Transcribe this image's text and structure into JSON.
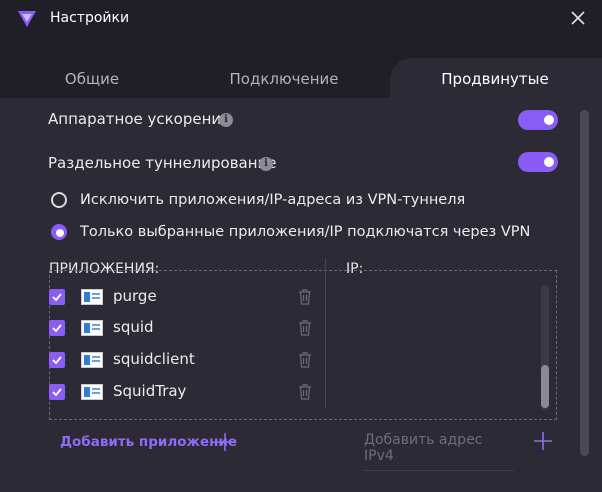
{
  "window": {
    "title": "Настройки"
  },
  "tabs": [
    {
      "label": "Общие"
    },
    {
      "label": "Подключение"
    },
    {
      "label": "Продвинутые"
    }
  ],
  "settings": {
    "hw_accel": {
      "label": "Аппаратное ускорение",
      "enabled": true
    },
    "split_tunnel": {
      "label": "Раздельное туннелирование",
      "enabled": true
    }
  },
  "radio": {
    "exclude": {
      "label": "Исключить приложения/IP-адреса из VPN-туннеля",
      "selected": false
    },
    "include": {
      "label": "Только выбранные приложения/IP подключатся через VPN",
      "selected": true
    }
  },
  "apps": {
    "header": "ПРИЛОЖЕНИЯ:",
    "items": [
      {
        "name": "purge",
        "checked": true
      },
      {
        "name": "squid",
        "checked": true
      },
      {
        "name": "squidclient",
        "checked": true
      },
      {
        "name": "SquidTray",
        "checked": true
      }
    ],
    "add_label": "Добавить приложение"
  },
  "ip": {
    "header": "IP:",
    "placeholder": "Добавить адрес IPv4"
  },
  "colors": {
    "accent": "#8a5cf6",
    "background": "#2b2a35",
    "header": "#201f27"
  }
}
